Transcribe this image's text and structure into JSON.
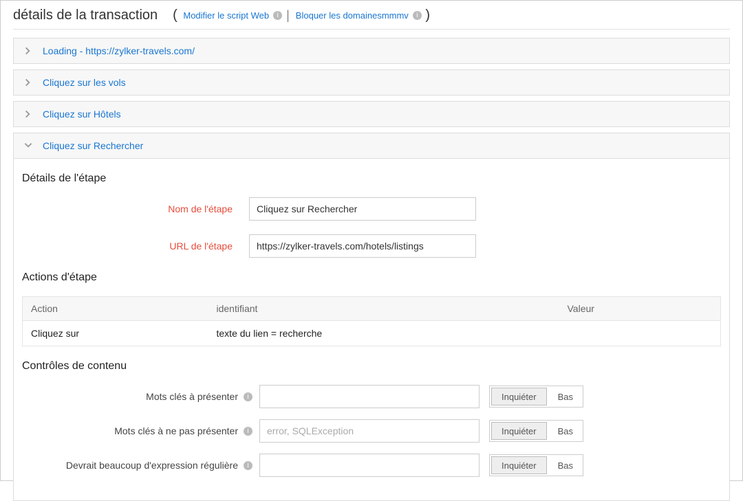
{
  "header": {
    "title": "détails de la transaction",
    "link_modify": "Modifier le script Web",
    "link_block": "Bloquer les domainesmmmv"
  },
  "steps": [
    {
      "label": "Loading - https://zylker-travels.com/",
      "expanded": false
    },
    {
      "label": "Cliquez sur les vols",
      "expanded": false
    },
    {
      "label": "Cliquez sur Hôtels",
      "expanded": false
    },
    {
      "label": "Cliquez sur Rechercher",
      "expanded": true
    }
  ],
  "step_details": {
    "section_title": "Détails de l'étape",
    "name_label": "Nom de l'étape",
    "name_value": "Cliquez sur Rechercher",
    "url_label": "URL de l'étape",
    "url_value": "https://zylker-travels.com/hotels/listings"
  },
  "actions": {
    "section_title": "Actions d'étape",
    "headers": {
      "action": "Action",
      "identifier": "identifiant",
      "value": "Valeur"
    },
    "rows": [
      {
        "action": "Cliquez sur",
        "identifier": "texte du lien = recherche",
        "value": ""
      }
    ]
  },
  "content_checks": {
    "section_title": "Contrôles de contenu",
    "rows": [
      {
        "label": "Mots clés à présenter",
        "value": "",
        "placeholder": "",
        "btn_active": "Inquiéter",
        "btn_inactive": "Bas"
      },
      {
        "label": "Mots clés à ne pas présenter",
        "value": "",
        "placeholder": "error, SQLException",
        "btn_active": "Inquiéter",
        "btn_inactive": "Bas"
      },
      {
        "label": "Devrait beaucoup d'expression régulière",
        "value": "",
        "placeholder": "",
        "btn_active": "Inquiéter",
        "btn_inactive": "Bas"
      }
    ]
  }
}
